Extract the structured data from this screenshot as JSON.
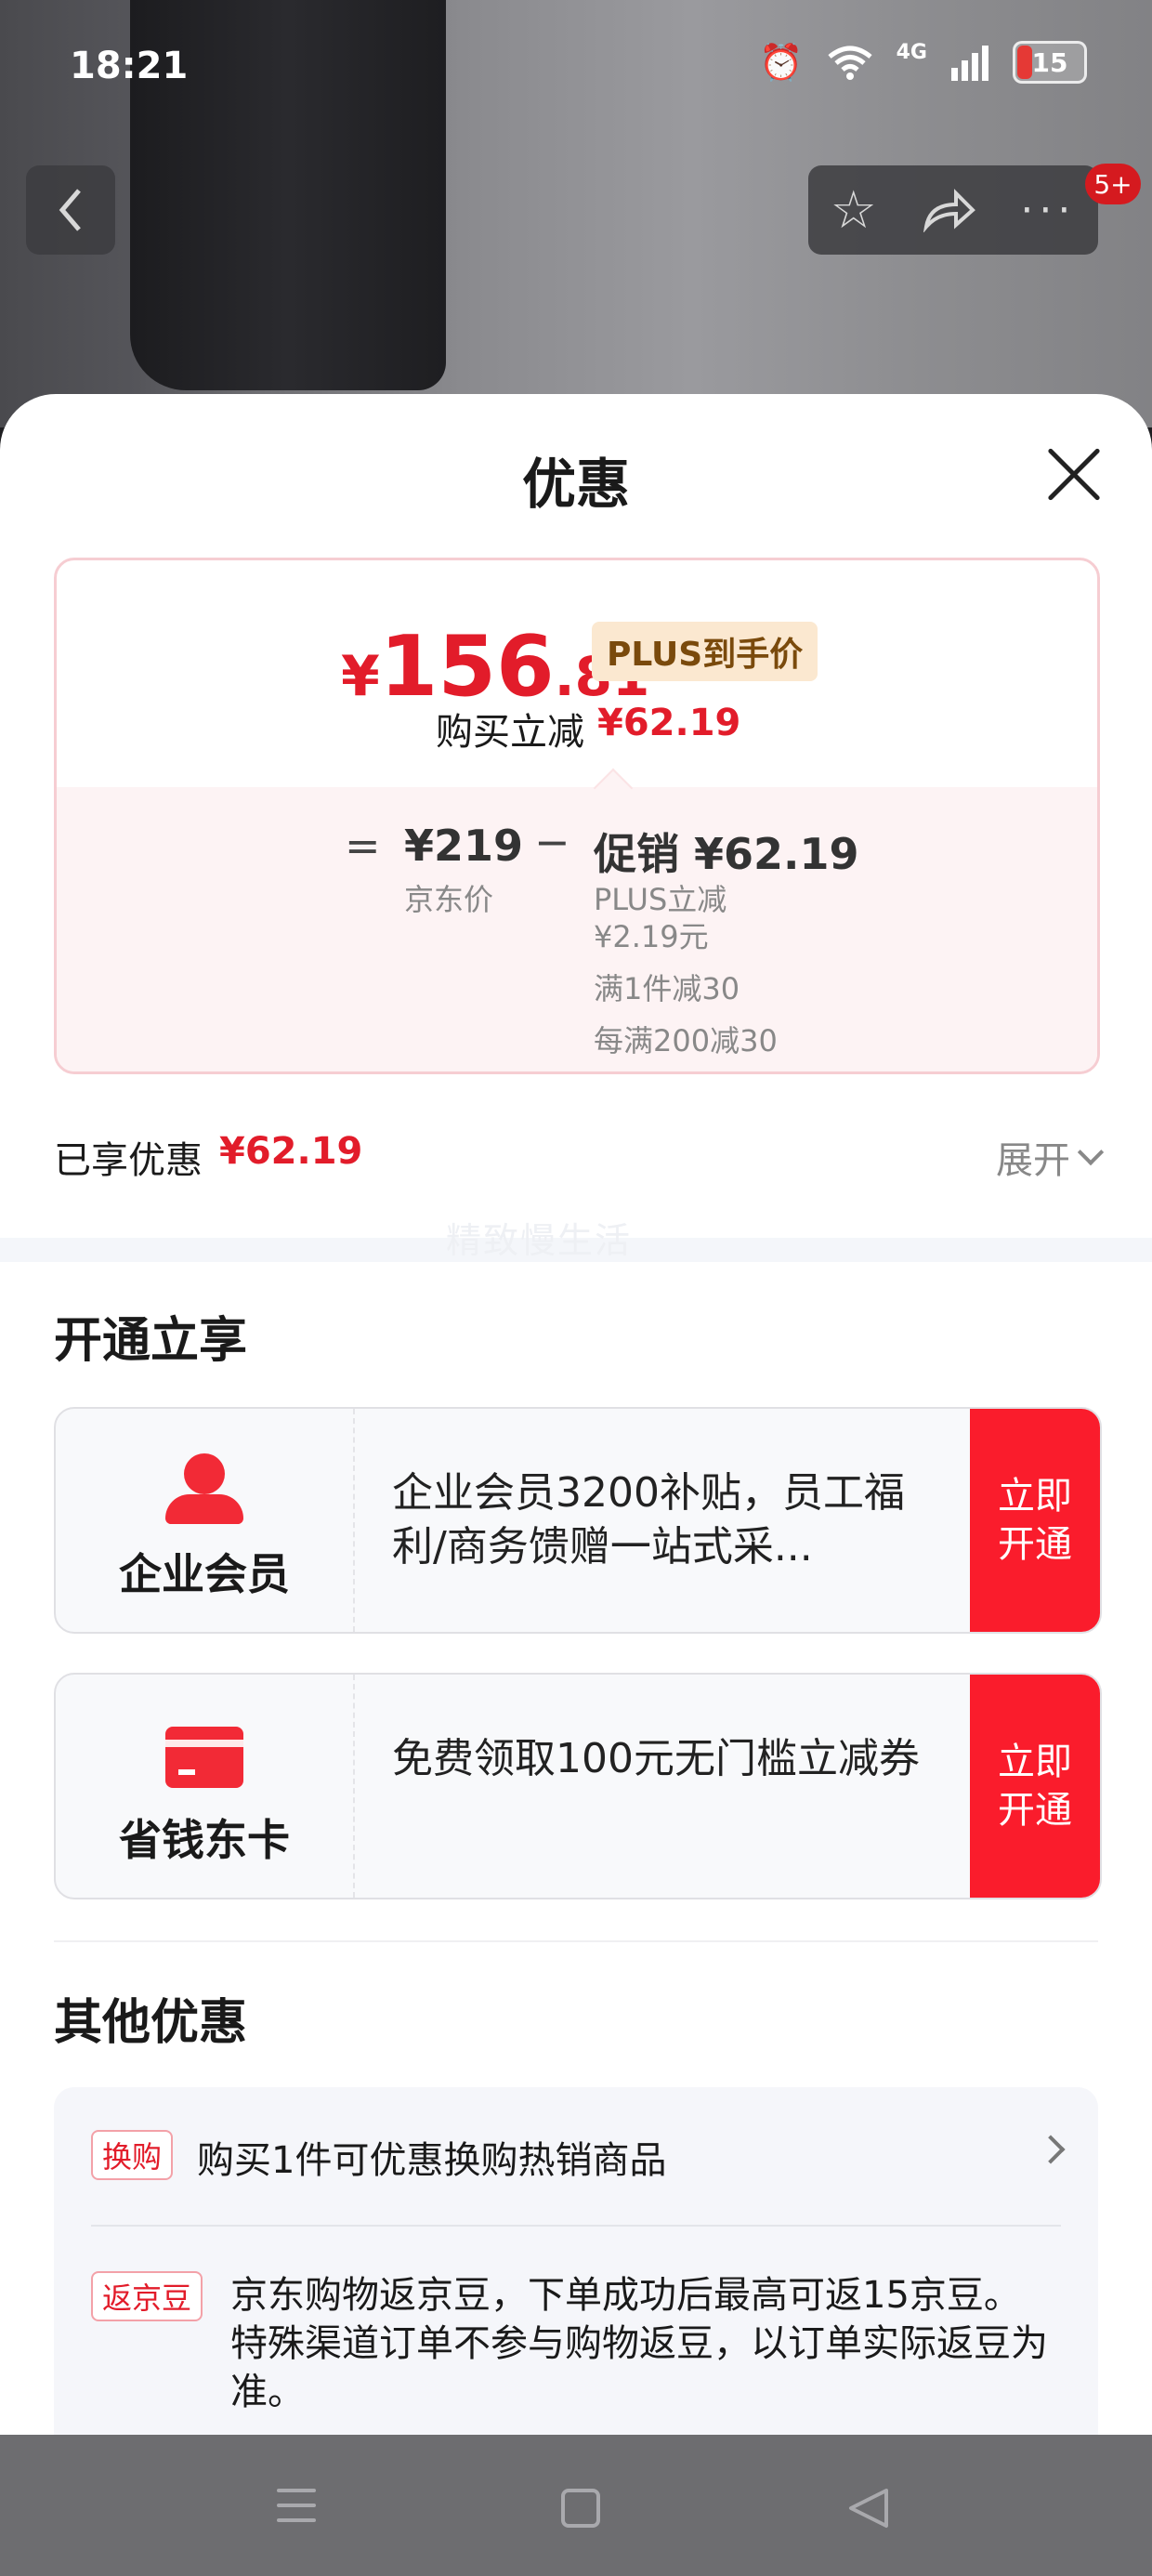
{
  "status_bar": {
    "time": "18:21",
    "battery": "15",
    "network": "4G"
  },
  "top_actions": {
    "badge": "5+"
  },
  "sheet": {
    "title": "优惠"
  },
  "price_summary": {
    "currency": "¥",
    "integer": "156",
    "decimal": ".81",
    "plus_tag": "PLUS到手价",
    "reduction_label": "购买立减",
    "reduction_amount": "¥62.19",
    "equals": "=",
    "minus": "−",
    "jd_price": "¥219",
    "jd_price_label": "京东价",
    "promo_label": "促销",
    "promo_amount": "¥62.19",
    "promo_lines": [
      "PLUS立减",
      "¥2.19元",
      "满1件减30",
      "每满200减30"
    ]
  },
  "enjoyed": {
    "label": "已享优惠",
    "amount": "¥62.19",
    "expand_label": "展开"
  },
  "watermark": "精致慢生活",
  "open_section": {
    "title": "开通立享",
    "cards": [
      {
        "name": "企业会员",
        "desc": "企业会员3200补贴，员工福利/商务馈赠一站式采...",
        "cta_line1": "立即",
        "cta_line2": "开通"
      },
      {
        "name": "省钱东卡",
        "desc": "免费领取100元无门槛立减券",
        "cta_line1": "立即",
        "cta_line2": "开通"
      }
    ]
  },
  "other_section": {
    "title": "其他优惠",
    "items": [
      {
        "tag": "换购",
        "text": "购买1件可优惠换购热销商品"
      },
      {
        "tag": "返京豆",
        "text": "京东购物返京豆，下单成功后最高可返15京豆。特殊渠道订单不参与购物返豆，以订单实际返豆为准。"
      }
    ]
  },
  "colors": {
    "accent_red": "#e21c2a",
    "cta_red": "#fa1c2c",
    "plus_tag_bg": "#fbe8d0"
  }
}
